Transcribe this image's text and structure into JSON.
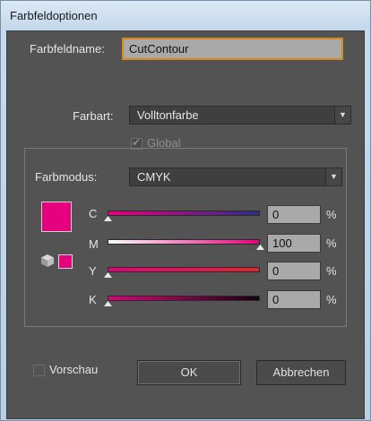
{
  "window": {
    "title": "Farbfeldoptionen"
  },
  "form": {
    "name_label": "Farbfeldname:",
    "name_value": "CutContour",
    "type_label": "Farbart:",
    "type_value": "Volltonfarbe",
    "global_label": "Global",
    "global_checked": true,
    "mode_label": "Farbmodus:",
    "mode_value": "CMYK"
  },
  "color": {
    "swatch": "#e6007e"
  },
  "sliders": [
    {
      "label": "C",
      "value": "0",
      "unit": "%"
    },
    {
      "label": "M",
      "value": "100",
      "unit": "%"
    },
    {
      "label": "Y",
      "value": "0",
      "unit": "%"
    },
    {
      "label": "K",
      "value": "0",
      "unit": "%"
    }
  ],
  "footer": {
    "preview_label": "Vorschau",
    "ok_label": "OK",
    "cancel_label": "Abbrechen"
  }
}
